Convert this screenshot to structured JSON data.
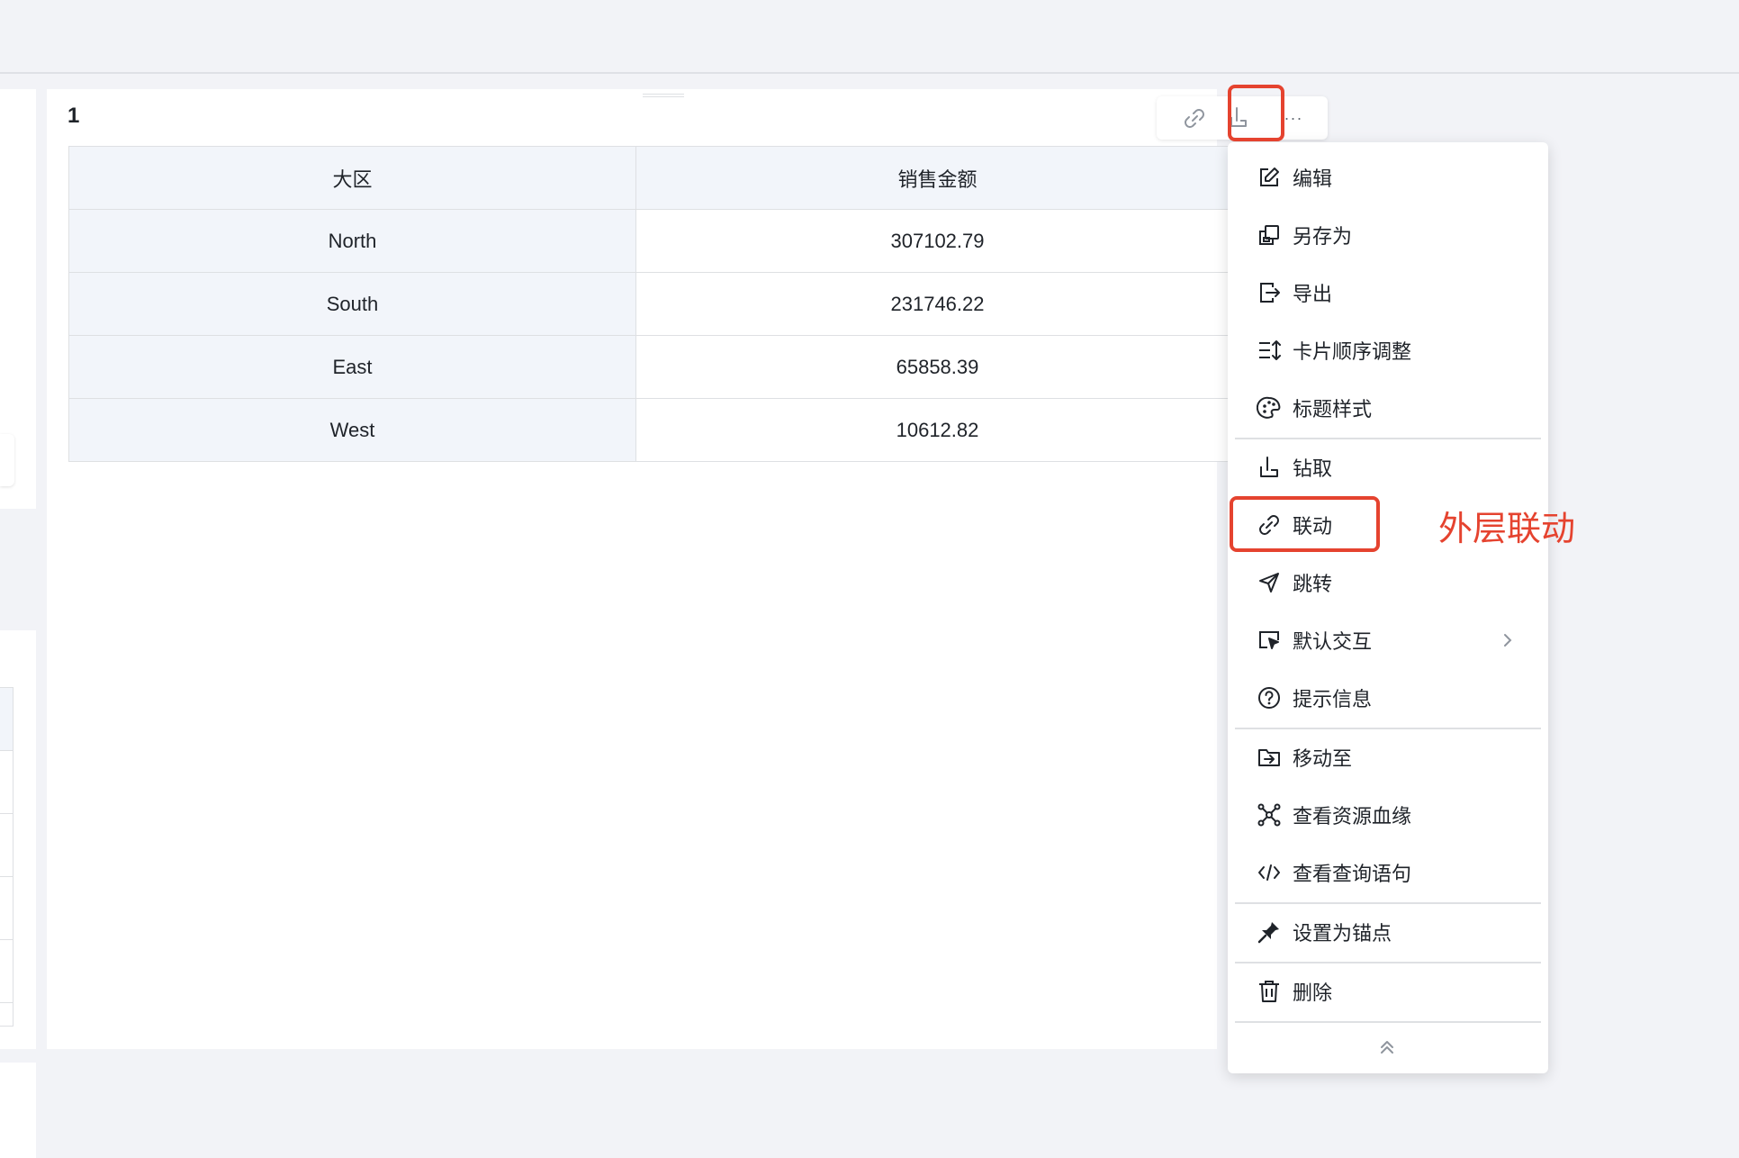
{
  "card": {
    "title": "1"
  },
  "table": {
    "headers": [
      "大区",
      "销售金额"
    ],
    "rows": [
      [
        "North",
        "307102.79"
      ],
      [
        "South",
        "231746.22"
      ],
      [
        "East",
        "65858.39"
      ],
      [
        "West",
        "10612.82"
      ]
    ]
  },
  "toolbar": {
    "icons": [
      "link-icon",
      "drill-icon",
      "more-icon"
    ],
    "more_label": "···"
  },
  "menu": {
    "items": [
      {
        "label": "编辑",
        "icon": "edit-icon"
      },
      {
        "label": "另存为",
        "icon": "save-as-icon"
      },
      {
        "label": "导出",
        "icon": "export-icon"
      },
      {
        "label": "卡片顺序调整",
        "icon": "reorder-icon"
      },
      {
        "label": "标题样式",
        "icon": "palette-icon"
      },
      {
        "label": "钻取",
        "icon": "drill-icon"
      },
      {
        "label": "联动",
        "icon": "link-icon"
      },
      {
        "label": "跳转",
        "icon": "send-icon"
      },
      {
        "label": "默认交互",
        "icon": "interaction-icon",
        "submenu": true
      },
      {
        "label": "提示信息",
        "icon": "help-icon"
      },
      {
        "label": "移动至",
        "icon": "move-folder-icon"
      },
      {
        "label": "查看资源血缘",
        "icon": "lineage-icon"
      },
      {
        "label": "查看查询语句",
        "icon": "code-icon"
      },
      {
        "label": "设置为锚点",
        "icon": "pin-icon"
      },
      {
        "label": "删除",
        "icon": "trash-icon"
      }
    ]
  },
  "annotation": {
    "text": "外层联动",
    "color": "#e5432f"
  },
  "colors": {
    "header_bg": "#f2f5fa",
    "border": "#dee0e3",
    "page_bg": "#f2f3f7",
    "highlight": "#e5432f"
  }
}
